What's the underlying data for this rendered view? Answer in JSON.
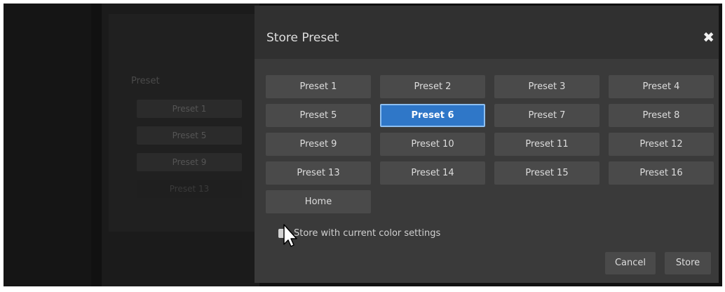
{
  "background": {
    "section_label": "Preset",
    "buttons": [
      "Preset 1",
      "Preset 5",
      "Preset 9",
      "Preset 13"
    ]
  },
  "dialog": {
    "title": "Store Preset",
    "close_icon": "close-icon",
    "presets": [
      "Preset 1",
      "Preset 2",
      "Preset 3",
      "Preset 4",
      "Preset 5",
      "Preset 6",
      "Preset 7",
      "Preset 8",
      "Preset 9",
      "Preset 10",
      "Preset 11",
      "Preset 12",
      "Preset 13",
      "Preset 14",
      "Preset 15",
      "Preset 16",
      "Home"
    ],
    "selected_preset": "Preset 6",
    "color_settings_label": "Store with current color settings",
    "color_settings_checked": false,
    "cancel_label": "Cancel",
    "store_label": "Store"
  },
  "colors": {
    "accent": "#2f77c8",
    "dialog_bg": "#3a3a3a",
    "button_bg": "#4a4a4a"
  }
}
